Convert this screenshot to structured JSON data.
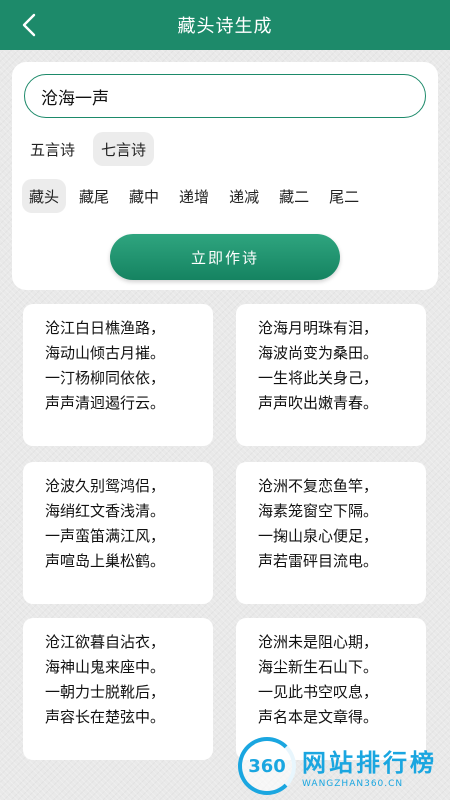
{
  "header": {
    "title": "藏头诗生成"
  },
  "input": {
    "value": "沧海一声"
  },
  "length_options": [
    {
      "label": "五言诗",
      "selected": false
    },
    {
      "label": "七言诗",
      "selected": true
    }
  ],
  "mode_options": [
    {
      "label": "藏头",
      "selected": true
    },
    {
      "label": "藏尾",
      "selected": false
    },
    {
      "label": "藏中",
      "selected": false
    },
    {
      "label": "递增",
      "selected": false
    },
    {
      "label": "递减",
      "selected": false
    },
    {
      "label": "藏二",
      "selected": false
    },
    {
      "label": "尾二",
      "selected": false
    }
  ],
  "submit": {
    "label": "立即作诗"
  },
  "poems": [
    {
      "lines": [
        "沧江白日樵渔路，",
        "海动山倾古月摧。",
        "一汀杨柳同依依，",
        "声声清迥遏行云。"
      ]
    },
    {
      "lines": [
        "沧海月明珠有泪，",
        "海波尚变为桑田。",
        "一生将此关身己，",
        "声声吹出嫩青春。"
      ]
    },
    {
      "lines": [
        "沧波久别鸳鸿侣，",
        "海绡红文香浅清。",
        "一声蛮笛满江风，",
        "声喧岛上巢松鹤。"
      ]
    },
    {
      "lines": [
        "沧洲不复恋鱼竿，",
        "海素笼窗空下隔。",
        "一掬山泉心便足，",
        "声若雷砰目流电。"
      ]
    },
    {
      "lines": [
        "沧江欲暮自沾衣，",
        "海神山鬼来座中。",
        "一朝力士脱靴后，",
        "声容长在楚弦中。"
      ]
    },
    {
      "lines": [
        "沧洲未是阻心期，",
        "海尘新生石山下。",
        "一见此书空叹息，",
        "声名本是文章得。"
      ]
    }
  ],
  "watermark": {
    "logo_text": "360",
    "name": "网站排行榜",
    "domain": "WANGZHAN360.CN"
  },
  "colors": {
    "brand_green": "#1d8a6a",
    "watermark_blue": "#1aa6e0"
  }
}
